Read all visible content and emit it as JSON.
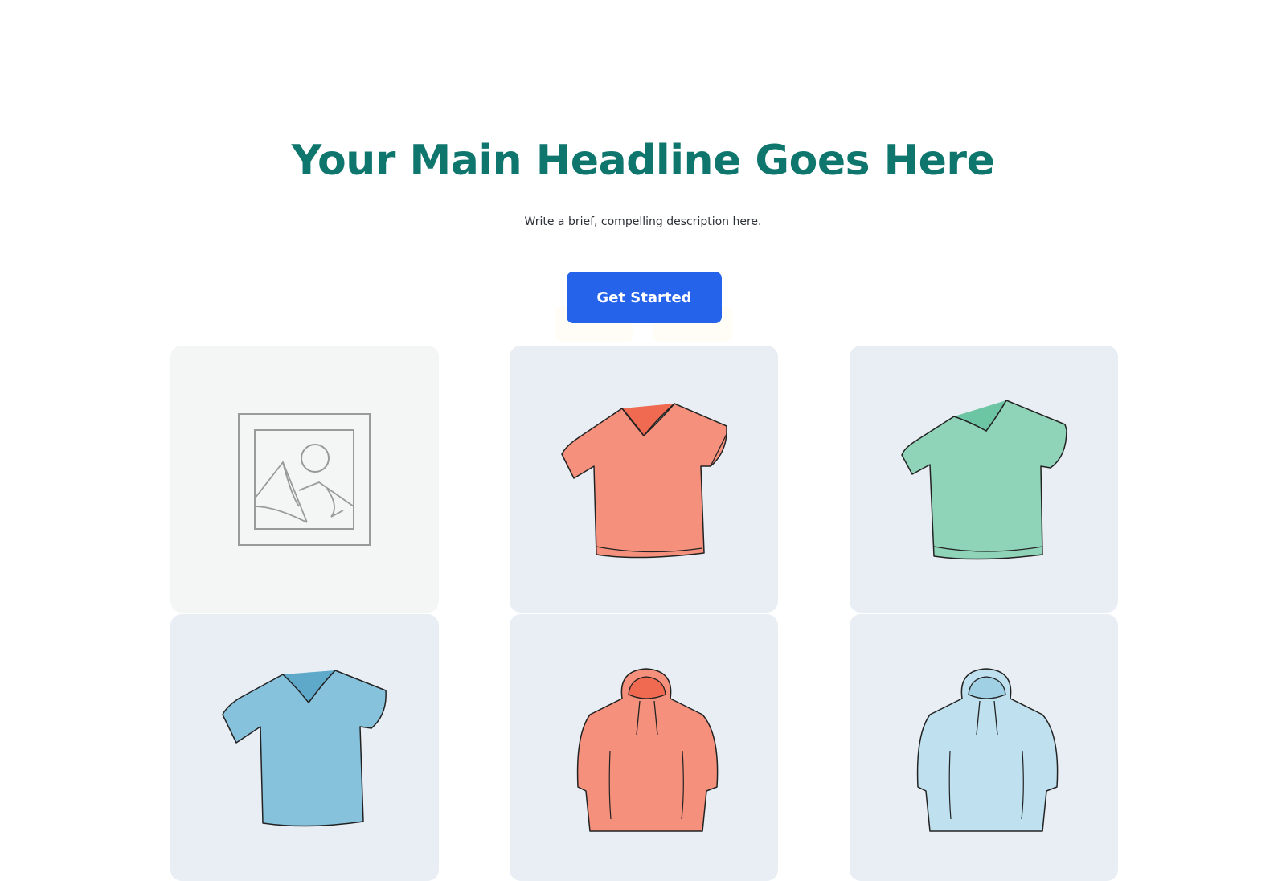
{
  "hero": {
    "headline": "Your Main Headline Goes Here",
    "subtitle": "Write a brief, compelling description here.",
    "cta_label": "Get Started"
  },
  "colors": {
    "headline": "#0f766e",
    "cta_background": "#2563eb",
    "card_background": "#e8eef3",
    "placeholder_background": "#f4f6f6"
  },
  "products": [
    {
      "name": "image-placeholder",
      "icon": "image-placeholder-icon"
    },
    {
      "name": "coral-v-neck-tshirt",
      "icon": "tshirt-icon",
      "color": "#f4907c"
    },
    {
      "name": "mint-v-neck-tshirt",
      "icon": "tshirt-icon",
      "color": "#8fd4b8"
    },
    {
      "name": "blue-v-neck-tshirt",
      "icon": "tshirt-icon",
      "color": "#86c2dc"
    },
    {
      "name": "coral-hoodie",
      "icon": "hoodie-icon",
      "color": "#f4907c"
    },
    {
      "name": "light-blue-hoodie",
      "icon": "hoodie-icon",
      "color": "#bfe0ee"
    }
  ]
}
